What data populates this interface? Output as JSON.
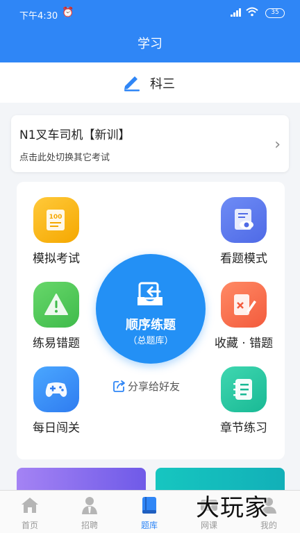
{
  "status_bar": {
    "time": "下午4:30",
    "battery": "35"
  },
  "header": {
    "title": "学习"
  },
  "subject": {
    "label": "科三"
  },
  "exam": {
    "title": "N1叉车司机【新训】",
    "hint": "点击此处切换其它考试"
  },
  "features": {
    "mock_exam": "模拟考试",
    "view_mode": "看题模式",
    "wrong_practice": "练易错题",
    "favorites_wrong": "收藏 · 错题",
    "daily_challenge": "每日闯关",
    "chapter_practice": "章节练习"
  },
  "center": {
    "title": "顺序练题",
    "subtitle": "（总题库）"
  },
  "share": {
    "label": "分享给好友"
  },
  "tabbar": {
    "items": [
      {
        "label": "首页",
        "icon": "home-icon"
      },
      {
        "label": "招聘",
        "icon": "person-icon"
      },
      {
        "label": "题库",
        "icon": "book-icon"
      },
      {
        "label": "网课",
        "icon": "video-icon"
      },
      {
        "label": "我的",
        "icon": "user-icon"
      }
    ],
    "active": "题库"
  },
  "watermark": {
    "text": "大玩家"
  },
  "colors": {
    "primary": "#2f86f6",
    "center_button": "#2390f5"
  }
}
